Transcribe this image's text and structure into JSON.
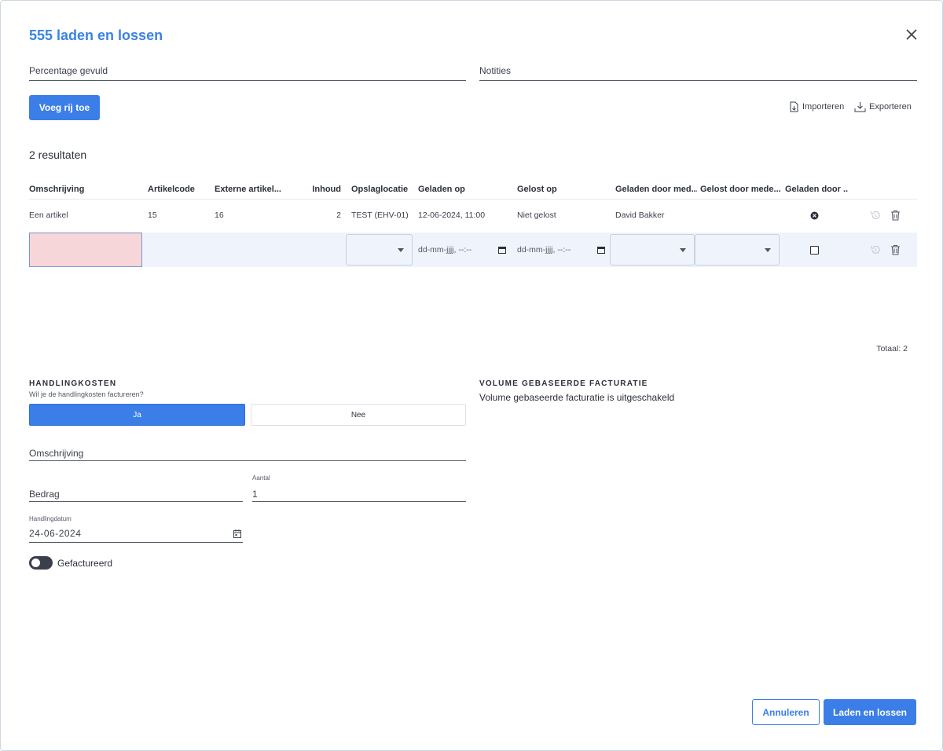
{
  "modal": {
    "title": "555 laden en lossen",
    "fields": {
      "percentage_label": "Percentage gevuld",
      "notes_label": "Notities"
    },
    "add_row_label": "Voeg rij toe",
    "import_label": "Importeren",
    "export_label": "Exporteren",
    "results_count": "2 resultaten",
    "table": {
      "headers": [
        "Omschrijving",
        "Artikelcode",
        "Externe artikel...",
        "Inhoud",
        "Opslaglocatie",
        "Geladen op",
        "Gelost op",
        "Geladen door med...",
        "Gelost door mede...",
        "Geladen door ..."
      ],
      "rows": [
        {
          "omschrijving": "Een artikel",
          "artikelcode": "15",
          "externe": "16",
          "inhoud": "2",
          "opslaglocatie": "TEST (EHV-01)",
          "geladen_op": "12-06-2024, 11:00",
          "gelost_op": "Niet gelost",
          "geladen_door": "David Bakker",
          "gelost_door": ""
        }
      ],
      "edit_row": {
        "geladen_op_placeholder": "dd-mm-jjjj, --:--",
        "gelost_op_placeholder": "dd-mm-jjjj, --:--"
      },
      "total": "Totaal: 2"
    },
    "handling": {
      "heading": "HANDLINGKOSTEN",
      "question": "Wil je de handlingkosten factureren?",
      "yes_label": "Ja",
      "no_label": "Nee",
      "description_label": "Omschrijving",
      "amount_label": "Bedrag",
      "quantity_label": "Aantal",
      "quantity_value": "1",
      "date_label": "Handlingdatum",
      "date_value": "24-06-2024",
      "invoiced_label": "Gefactureerd"
    },
    "volume": {
      "heading": "VOLUME GEBASEERDE FACTURATIE",
      "text": "Volume gebaseerde facturatie is uitgeschakeld"
    },
    "footer": {
      "cancel_label": "Annuleren",
      "submit_label": "Laden en lossen"
    },
    "colors": {
      "accent": "#3b7ee8",
      "invalid_field": "#f6d6d9"
    }
  }
}
